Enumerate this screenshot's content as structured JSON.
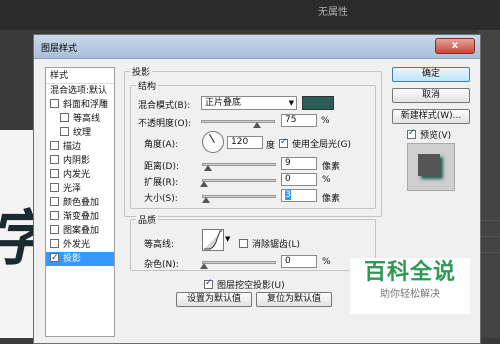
{
  "background": {
    "panel_title": "无属性",
    "brush_text": "字"
  },
  "dialog": {
    "title": "图层样式",
    "close_label": "x",
    "sidebar": {
      "header": "样式",
      "items": [
        {
          "label": "混合选项:默认",
          "checkbox": false,
          "has_checkbox": false
        },
        {
          "label": "斜面和浮雕",
          "checkbox": false,
          "has_checkbox": true
        },
        {
          "label": "等高线",
          "checkbox": false,
          "has_checkbox": true,
          "indent": true
        },
        {
          "label": "纹理",
          "checkbox": false,
          "has_checkbox": true,
          "indent": true
        },
        {
          "label": "描边",
          "checkbox": false,
          "has_checkbox": true
        },
        {
          "label": "内阴影",
          "checkbox": false,
          "has_checkbox": true
        },
        {
          "label": "内发光",
          "checkbox": false,
          "has_checkbox": true
        },
        {
          "label": "光泽",
          "checkbox": false,
          "has_checkbox": true
        },
        {
          "label": "颜色叠加",
          "checkbox": false,
          "has_checkbox": true
        },
        {
          "label": "渐变叠加",
          "checkbox": false,
          "has_checkbox": true
        },
        {
          "label": "图案叠加",
          "checkbox": false,
          "has_checkbox": true
        },
        {
          "label": "外发光",
          "checkbox": false,
          "has_checkbox": true
        },
        {
          "label": "投影",
          "checkbox": true,
          "has_checkbox": true,
          "selected": true
        }
      ]
    },
    "shadow_group": "投影",
    "structure": {
      "legend": "结构",
      "blend_mode_label": "混合模式(B):",
      "blend_mode_value": "正片叠底",
      "shadow_color": "#2b5e56",
      "opacity_label": "不透明度(O):",
      "opacity_value": "75",
      "opacity_fraction": 0.75,
      "percent": "%",
      "angle_label": "角度(A):",
      "angle_value": "120",
      "angle_unit": "度",
      "global_light_label": "使用全局光(G)",
      "global_light_checked": true,
      "distance_label": "距离(D):",
      "distance_value": "9",
      "spread_label": "扩展(R):",
      "spread_value": "0",
      "size_label": "大小(S):",
      "size_value": "3",
      "pixels": "像素"
    },
    "quality": {
      "legend": "品质",
      "contour_label": "等高线:",
      "antialias_label": "消除锯齿(L)",
      "antialias_checked": false,
      "noise_label": "杂色(N):",
      "noise_value": "0",
      "percent": "%"
    },
    "knockout_label": "图层挖空投影(U)",
    "knockout_checked": true,
    "make_default": "设置为默认值",
    "reset_default": "复位为默认值",
    "buttons": {
      "ok": "确定",
      "cancel": "取消",
      "new_style": "新建样式(W)...",
      "preview_label": "预览(V)",
      "preview_checked": true
    }
  },
  "watermark": {
    "main": "百科全说",
    "sub": "助你轻松解决"
  }
}
